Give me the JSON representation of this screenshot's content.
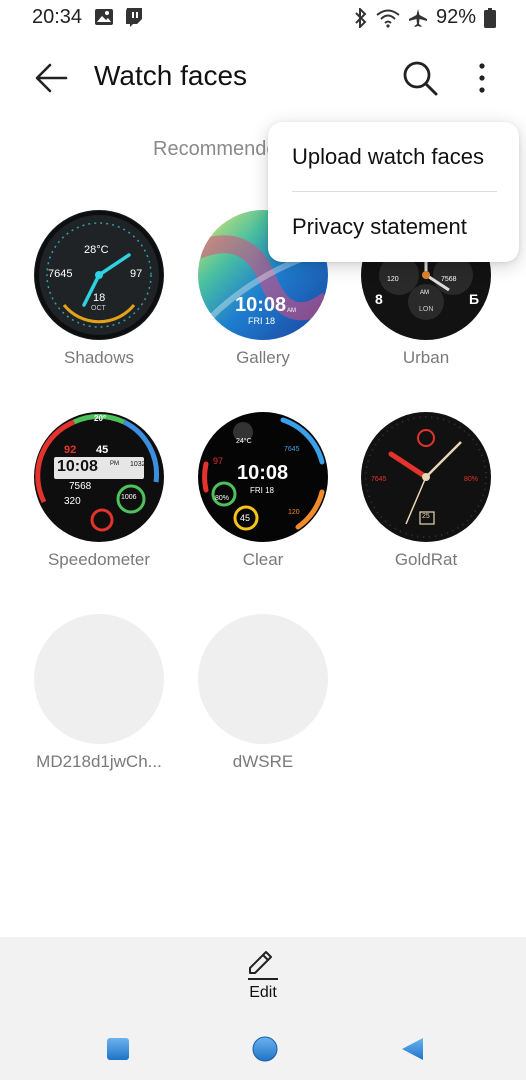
{
  "status_bar": {
    "time": "20:34",
    "battery": "92%"
  },
  "header": {
    "title": "Watch faces"
  },
  "section": {
    "label": "Recommended"
  },
  "menu": {
    "items": [
      {
        "label": "Upload watch faces"
      },
      {
        "label": "Privacy statement"
      }
    ]
  },
  "faces": [
    {
      "name": "Shadows",
      "temp": "28°C",
      "steps": "7645",
      "hr": "97",
      "date": "18",
      "month": "OCT"
    },
    {
      "name": "Gallery",
      "time": "10:08",
      "date": "FRI 18",
      "ampm": "AM"
    },
    {
      "name": "Urban",
      "a": "120",
      "b": "7568",
      "ampm": "AM",
      "city": "LON"
    },
    {
      "name": "Speedometer",
      "time": "10:08",
      "ampm": "PM",
      "hr": "92",
      "stress": "45",
      "steps": "7568",
      "cal": "320",
      "temp": "20°",
      "v1": "1032",
      "v2": "1006"
    },
    {
      "name": "Clear",
      "time": "10:08",
      "date": "FRI 18",
      "temp": "24°C",
      "hr": "97",
      "steps": "7645",
      "cal": "120",
      "battery": "80%",
      "v": "45"
    },
    {
      "name": "GoldRat",
      "steps": "7645",
      "battery": "80%",
      "date": "25"
    },
    {
      "name": "MD218d1jwCh..."
    },
    {
      "name": "dWSRE"
    }
  ],
  "bottom": {
    "edit_label": "Edit"
  },
  "colors": {
    "accent": "#1a73c9",
    "nav_blue": "#2f8ad8",
    "background": "#ffffff",
    "bar": "#f2f2f2"
  }
}
